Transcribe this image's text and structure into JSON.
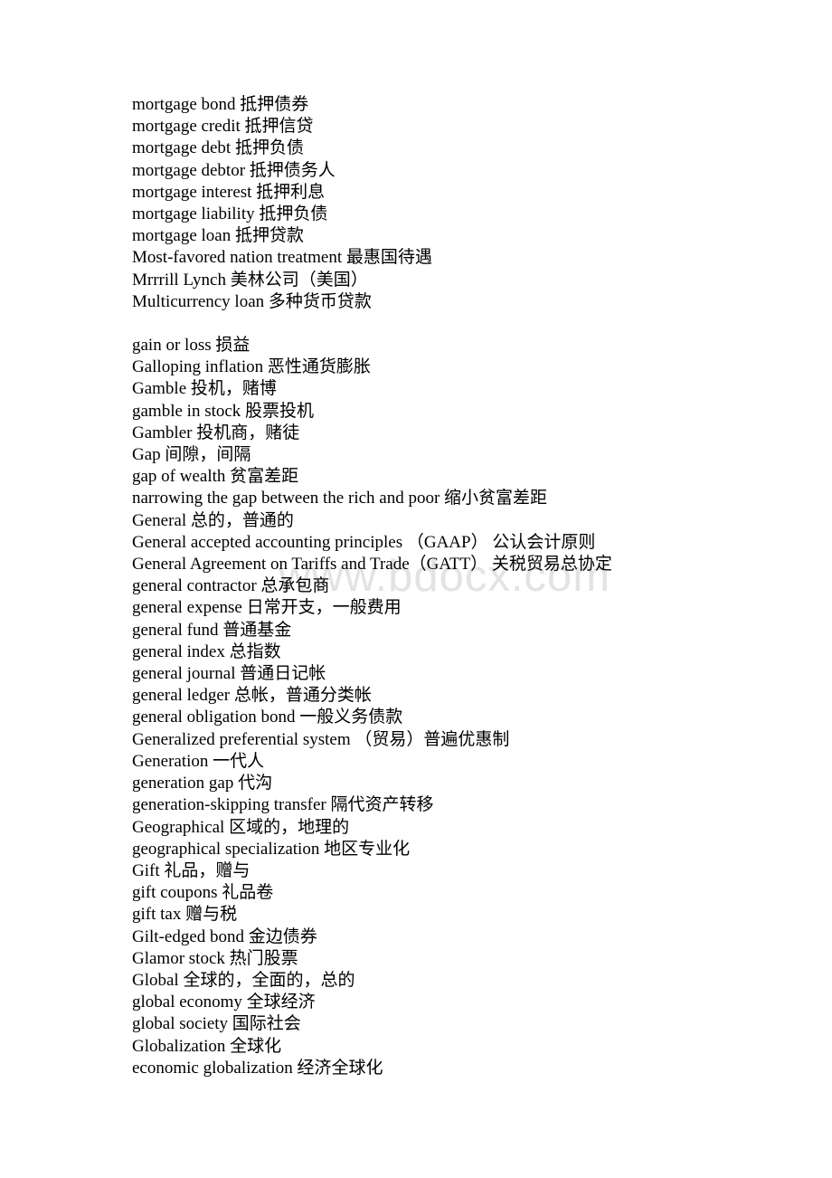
{
  "document": {
    "watermark": "www.bdocx.com",
    "watermark_color": "#e3e3e3",
    "background_color": "#ffffff",
    "text_color": "#000000",
    "blocks": [
      {
        "id": "block-m",
        "entries": [
          "mortgage bond 抵押债券",
          "mortgage credit 抵押信贷",
          "mortgage debt 抵押负债",
          "mortgage debtor 抵押债务人",
          "mortgage interest 抵押利息",
          "mortgage liability 抵押负债",
          "mortgage loan 抵押贷款",
          "Most-favored nation treatment 最惠国待遇",
          "Mrrrill Lynch 美林公司（美国）",
          "Multicurrency loan 多种货币贷款"
        ]
      },
      {
        "id": "block-g",
        "entries": [
          "gain or loss 损益",
          "Galloping inflation 恶性通货膨胀",
          "Gamble 投机，赌博",
          "gamble in stock 股票投机",
          "Gambler 投机商，赌徒",
          "Gap 间隙，间隔",
          "gap of wealth 贫富差距",
          "narrowing the gap between the rich and poor 缩小贫富差距",
          "General 总的，普通的",
          "General accepted accounting principles （GAAP） 公认会计原则",
          "General Agreement on Tariffs and Trade（GATT） 关税贸易总协定",
          "general contractor 总承包商",
          "general expense 日常开支，一般费用",
          "general fund 普通基金",
          "general index 总指数",
          "general journal 普通日记帐",
          "general ledger 总帐，普通分类帐",
          "general obligation bond 一般义务债款",
          "Generalized preferential system （贸易）普遍优惠制",
          "Generation 一代人",
          "generation gap 代沟",
          "generation-skipping transfer 隔代资产转移",
          "Geographical 区域的，地理的",
          "geographical specialization 地区专业化",
          "Gift 礼品，赠与",
          "gift coupons 礼品卷",
          "gift tax 赠与税",
          "Gilt-edged bond 金边债券",
          "Glamor stock 热门股票",
          "Global 全球的，全面的，总的",
          "global economy 全球经济",
          "global society 国际社会",
          "Globalization 全球化",
          "economic globalization 经济全球化"
        ]
      }
    ]
  }
}
